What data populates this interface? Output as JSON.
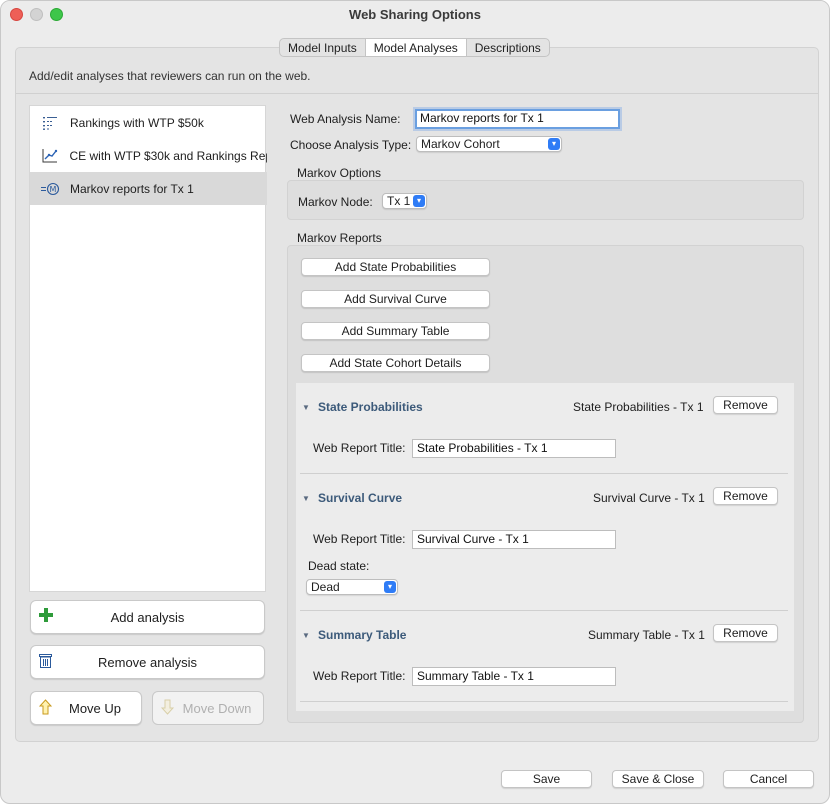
{
  "window": {
    "title": "Web Sharing Options"
  },
  "tabs": [
    {
      "label": "Model Inputs"
    },
    {
      "label": "Model Analyses"
    },
    {
      "label": "Descriptions"
    }
  ],
  "description": "Add/edit analyses that reviewers can run on the web.",
  "analyses": [
    {
      "label": "Rankings with WTP $50k",
      "icon": "rankings-list-icon"
    },
    {
      "label": "CE with WTP $30k and Rankings Rep",
      "icon": "ce-graph-icon"
    },
    {
      "label": "Markov reports for Tx 1",
      "icon": "markov-icon"
    }
  ],
  "left_buttons": {
    "add": "Add analysis",
    "remove": "Remove analysis",
    "move_up": "Move Up",
    "move_down": "Move Down"
  },
  "form": {
    "name_label": "Web Analysis Name:",
    "name_value": "Markov reports for Tx 1",
    "type_label": "Choose Analysis Type:",
    "type_value": "Markov Cohort"
  },
  "markov_options": {
    "title": "Markov Options",
    "node_label": "Markov Node:",
    "node_value": "Tx 1"
  },
  "markov_reports": {
    "title": "Markov Reports",
    "add_buttons": [
      "Add State Probabilities",
      "Add Survival Curve",
      "Add Summary Table",
      "Add State Cohort Details"
    ],
    "reports": [
      {
        "name": "State Probabilities",
        "subtitle": "State Probabilities - Tx 1",
        "title_label": "Web Report Title:",
        "title_value": "State Probabilities - Tx 1",
        "remove": "Remove"
      },
      {
        "name": "Survival Curve",
        "subtitle": "Survival Curve - Tx 1",
        "title_label": "Web Report Title:",
        "title_value": "Survival Curve - Tx 1",
        "remove": "Remove",
        "dead_label": "Dead state:",
        "dead_value": "Dead"
      },
      {
        "name": "Summary Table",
        "subtitle": "Summary Table - Tx 1",
        "title_label": "Web Report Title:",
        "title_value": "Summary Table - Tx 1",
        "remove": "Remove"
      }
    ]
  },
  "bottom_buttons": {
    "save": "Save",
    "save_close": "Save & Close",
    "cancel": "Cancel"
  },
  "colors": {
    "accent": "#2f7cf6",
    "focus_ring": "#6a9fe0",
    "add_green": "#2e9b3a"
  }
}
